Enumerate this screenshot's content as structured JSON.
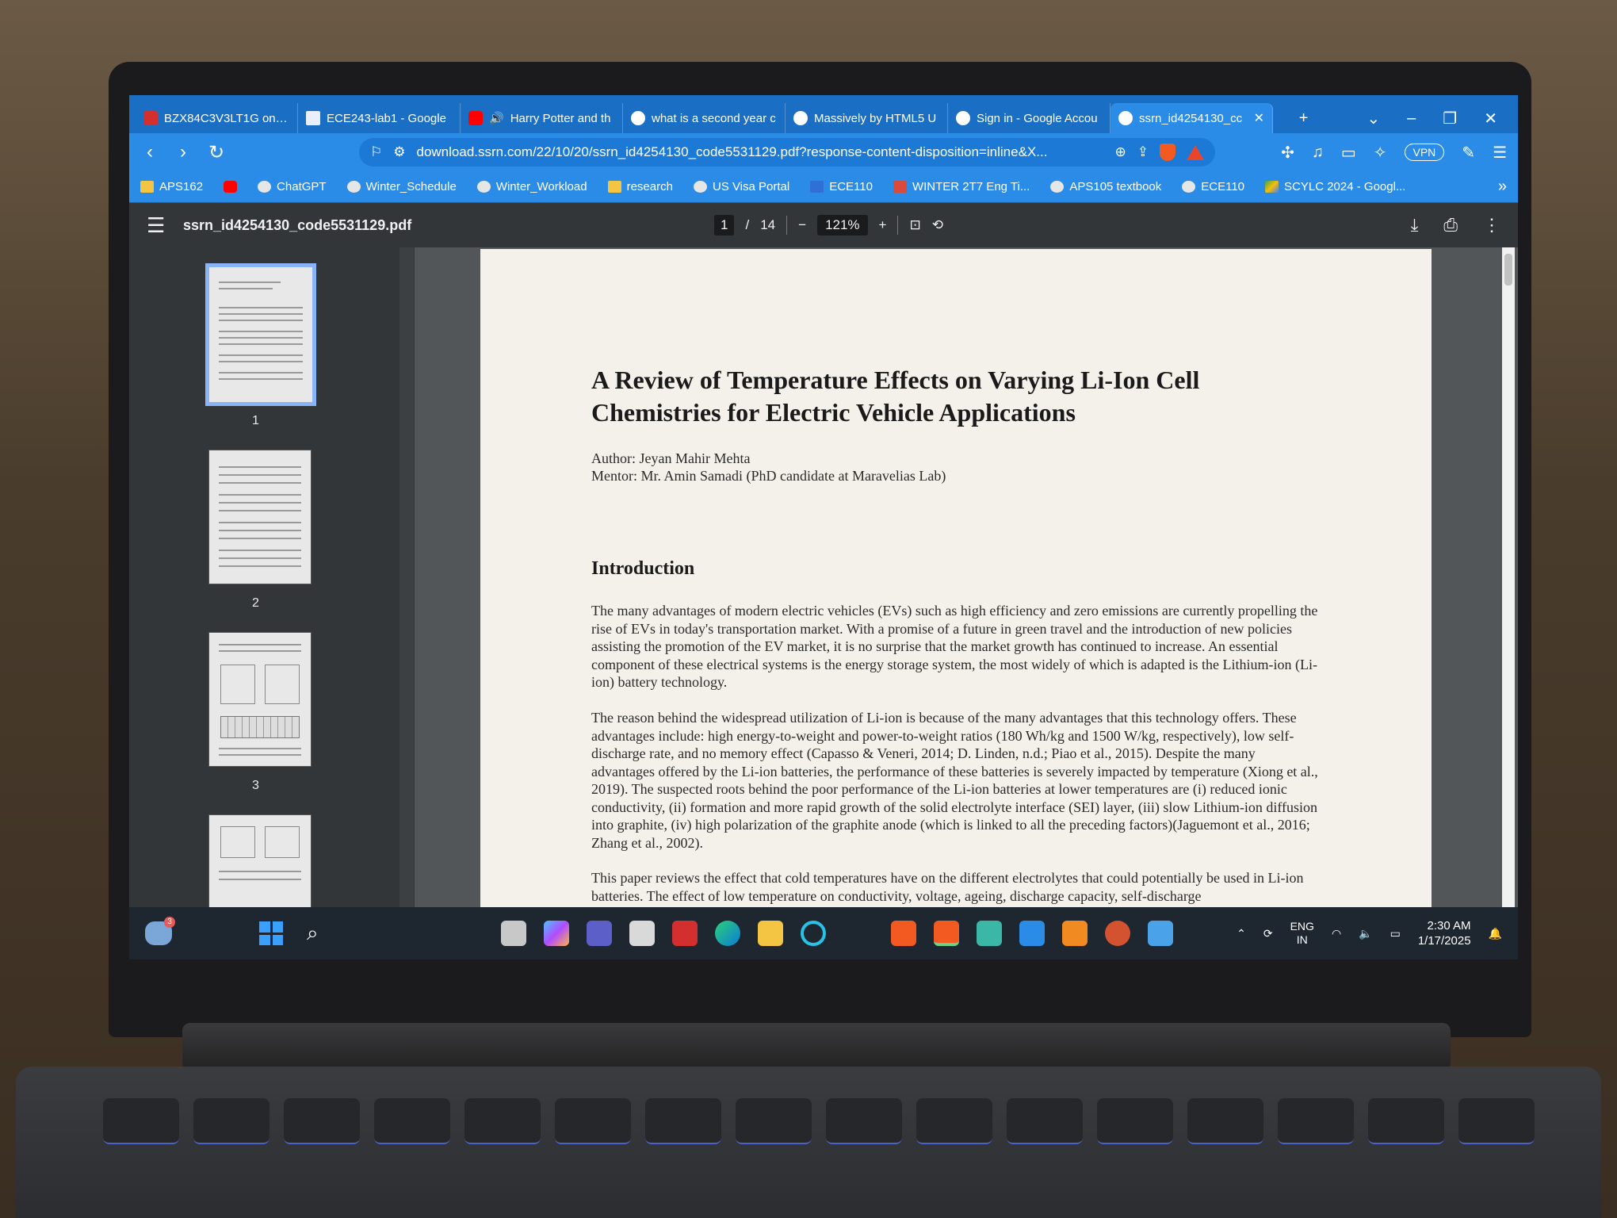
{
  "tabs": [
    {
      "label": "BZX84C3V3LT1G onsen",
      "icon": "pdf-red-icon"
    },
    {
      "label": "ECE243-lab1 - Google",
      "icon": "docs-icon"
    },
    {
      "label": "Harry Potter and th",
      "icon": "youtube-icon"
    },
    {
      "label": "what is a second year c",
      "icon": "globe-icon"
    },
    {
      "label": "Massively by HTML5 U",
      "icon": "globe-icon"
    },
    {
      "label": "Sign in - Google Accou",
      "icon": "google-icon"
    },
    {
      "label": "ssrn_id4254130_cc",
      "icon": "globe-icon",
      "active": true
    }
  ],
  "tab_controls": {
    "new_tab": "+",
    "dropdown": "⌄",
    "minimize": "–",
    "restore": "❐",
    "close": "✕"
  },
  "toolbar": {
    "url": "download.ssrn.com/22/10/20/ssrn_id4254130_code5531129.pdf?response-content-disposition=inline&X...",
    "vpn_label": "VPN"
  },
  "bookmarks": [
    {
      "label": "APS162",
      "icon": "folder-icon"
    },
    {
      "label": "",
      "icon": "youtube-icon"
    },
    {
      "label": "ChatGPT",
      "icon": "chatgpt-icon"
    },
    {
      "label": "Winter_Schedule",
      "icon": "globe-icon"
    },
    {
      "label": "Winter_Workload",
      "icon": "globe-icon"
    },
    {
      "label": "research",
      "icon": "folder-icon"
    },
    {
      "label": "US Visa Portal",
      "icon": "link-icon"
    },
    {
      "label": "ECE110",
      "icon": "blue-app-icon"
    },
    {
      "label": "WINTER 2T7 Eng Ti...",
      "icon": "red-app-icon"
    },
    {
      "label": "APS105 textbook",
      "icon": "globe-icon"
    },
    {
      "label": "ECE110",
      "icon": "file-icon"
    },
    {
      "label": "SCYLC 2024 - Googl...",
      "icon": "drive-icon"
    }
  ],
  "pdf": {
    "filename": "ssrn_id4254130_code5531129.pdf",
    "current_page": "1",
    "total_pages": "14",
    "zoom": "121%",
    "thumbnails": [
      "1",
      "2",
      "3"
    ]
  },
  "document": {
    "title": "A Review of Temperature Effects on Varying Li-Ion Cell Chemistries for Electric Vehicle Applications",
    "author": "Author: Jeyan Mahir Mehta",
    "mentor": "Mentor: Mr. Amin Samadi (PhD candidate at Maravelias Lab)",
    "section_heading": "Introduction",
    "paragraphs": [
      "The many advantages of modern electric vehicles (EVs) such as high efficiency and zero emissions are currently propelling the rise of EVs in today's transportation market. With a promise of a future in green travel and the introduction of new policies assisting the promotion of the EV market, it is no surprise that the market growth has continued to increase. An essential component of these electrical systems is the energy storage system, the most widely of which is adapted is the Lithium-ion (Li-ion) battery technology.",
      "The reason behind the widespread utilization of Li-ion is because of the many advantages that this technology offers. These advantages include: high energy-to-weight and power-to-weight ratios (180 Wh/kg and 1500 W/kg, respectively), low self-discharge rate, and no memory effect (Capasso & Veneri, 2014; D. Linden, n.d.; Piao et al., 2015). Despite the many advantages offered by the Li-ion batteries, the performance of these batteries is severely impacted by temperature (Xiong et al., 2019). The suspected roots behind the poor performance of the Li-ion batteries at lower temperatures are (i) reduced ionic conductivity, (ii) formation and more rapid growth of the solid electrolyte interface (SEI) layer, (iii) slow Lithium-ion diffusion into graphite, (iv) high polarization of the graphite anode (which is linked to all the preceding factors)(Jaguemont et al., 2016; Zhang et al., 2002).",
      "This paper reviews the effect that cold temperatures have on the different electrolytes that could potentially be used in Li-ion batteries. The effect of low temperature on conductivity, voltage, ageing, discharge capacity, self-discharge"
    ]
  },
  "taskbar": {
    "weather_badge": "3",
    "language": "ENG",
    "region": "IN",
    "time": "2:30 AM",
    "date": "1/17/2025"
  }
}
